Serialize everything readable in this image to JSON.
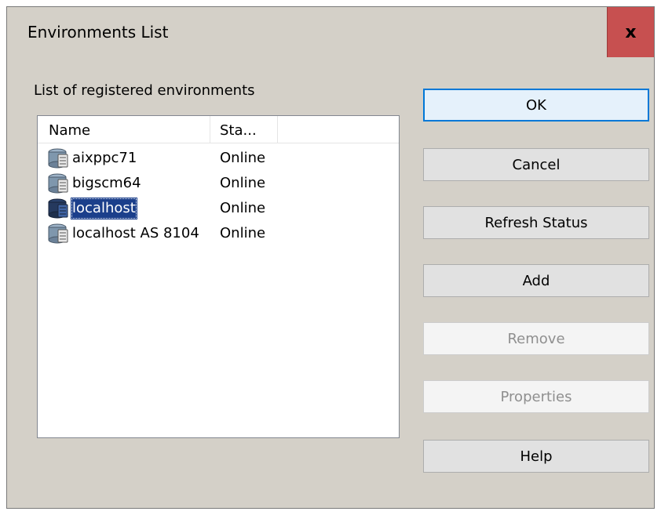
{
  "window": {
    "title": "Environments List",
    "close_label": "x"
  },
  "list": {
    "label": "List of registered environments",
    "columns": [
      "Name",
      "Sta..."
    ],
    "rows": [
      {
        "name": "aixppc71",
        "status": "Online"
      },
      {
        "name": "bigscm64",
        "status": "Online"
      },
      {
        "name": "localhost",
        "status": "Online",
        "selected": true
      },
      {
        "name": "localhost AS 8104",
        "status": "Online"
      }
    ],
    "row_icon": "server-icon",
    "selection_color": "#1b3f8b"
  },
  "buttons": {
    "ok": "OK",
    "cancel": "Cancel",
    "refresh": "Refresh Status",
    "add": "Add",
    "remove": "Remove",
    "properties": "Properties",
    "help": "Help"
  },
  "colors": {
    "dialog_bg": "#d4d0c8",
    "close_bg": "#c75050",
    "default_button_border": "#0078d7"
  }
}
